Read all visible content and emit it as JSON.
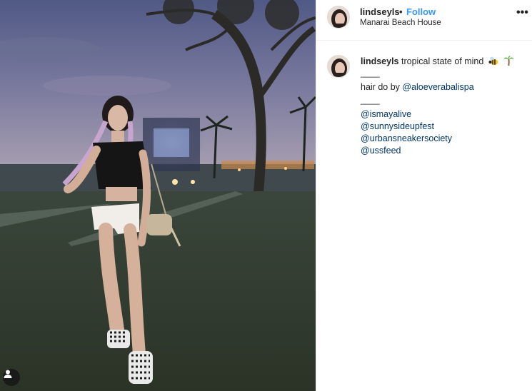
{
  "header": {
    "username": "lindseyls",
    "separator": "•",
    "follow_label": "Follow",
    "location": "Manarai Beach House",
    "more_label": "•••"
  },
  "caption": {
    "username": "lindseyls",
    "text": "tropical state of mind",
    "emojis": [
      "bee-emoji",
      "palm-tree-emoji"
    ],
    "divider_1": "____",
    "credit_prefix": "hair do by",
    "credit_mention": "@aloeverabalispa",
    "divider_2": "____",
    "mentions": [
      "@ismayalive",
      "@sunnysideupfest",
      "@urbansneakersociety",
      "@ussfeed"
    ]
  },
  "colors": {
    "link_blue": "#3897f0",
    "mention_blue": "#003569",
    "text": "#262626",
    "border": "#efefef"
  }
}
